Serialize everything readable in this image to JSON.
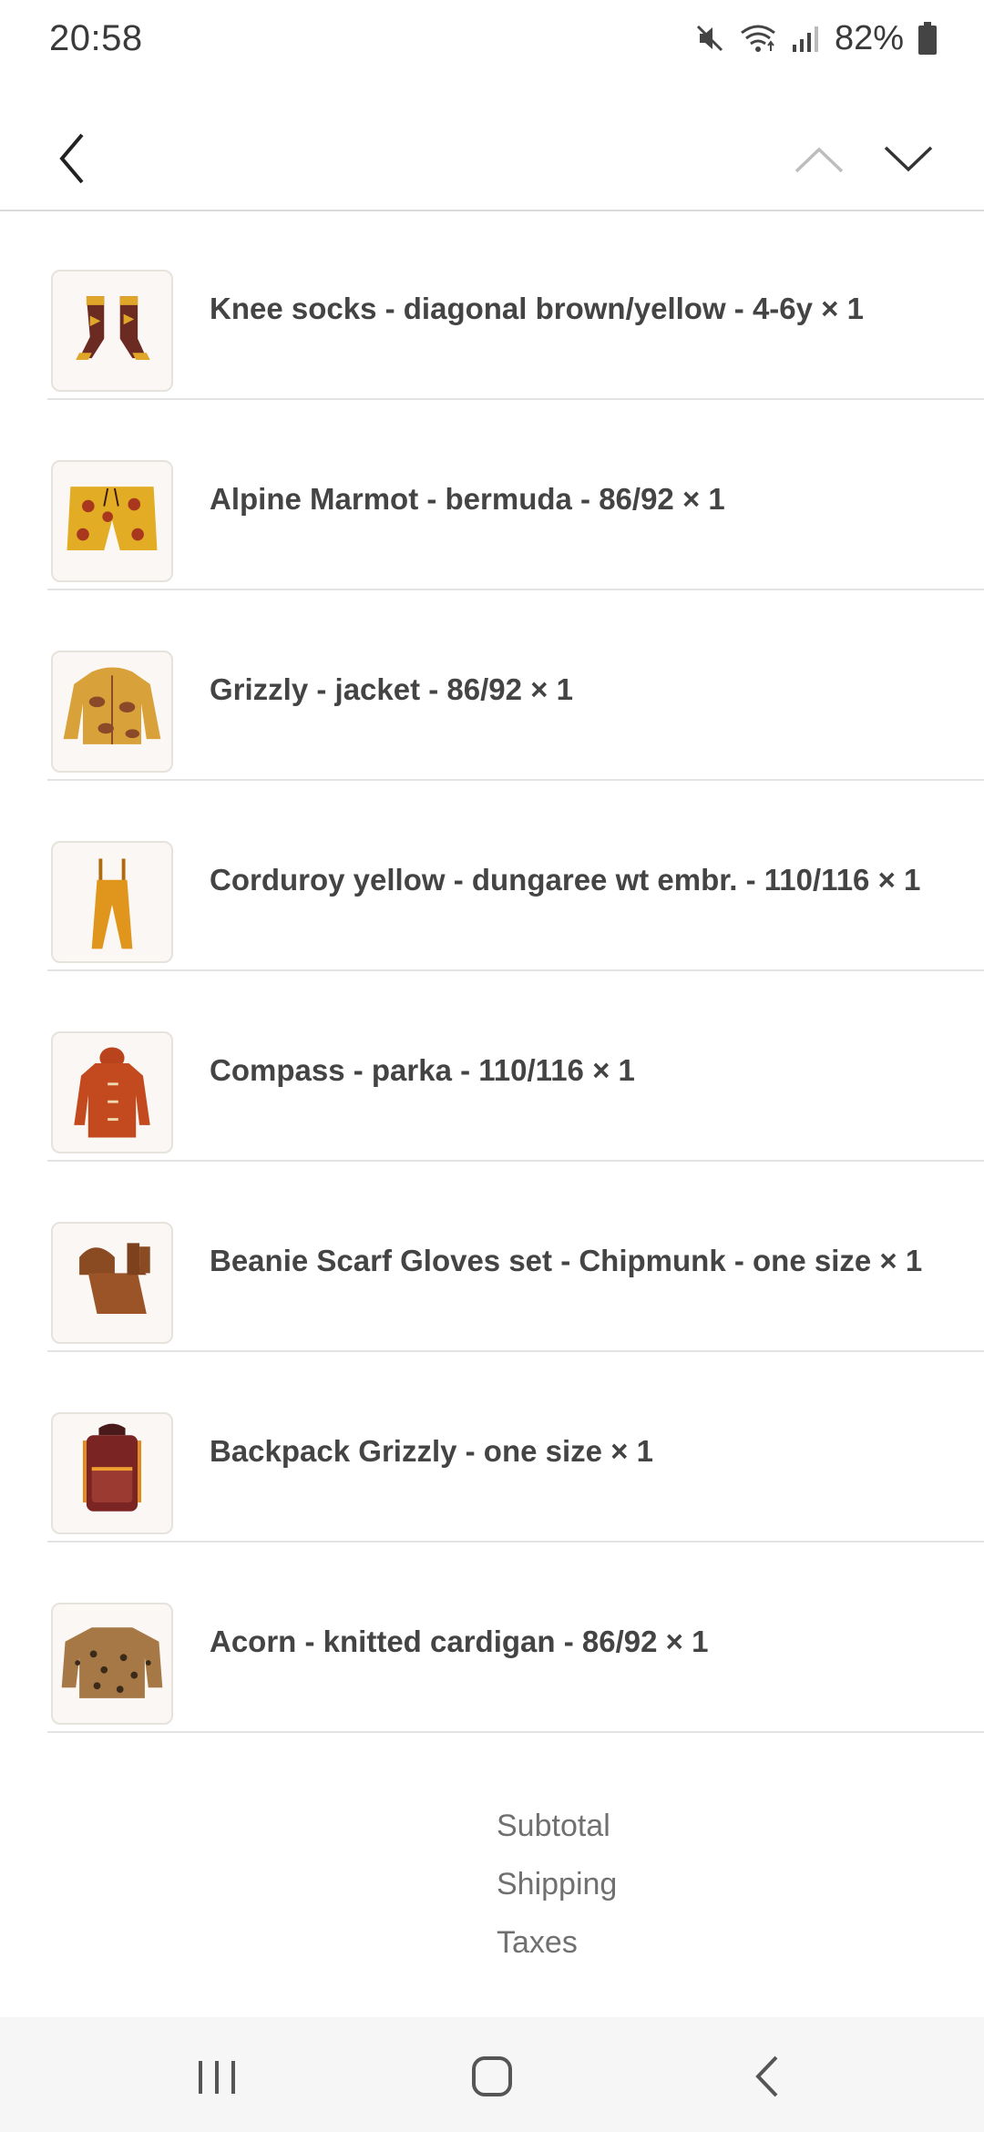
{
  "status_bar": {
    "time": "20:58",
    "battery": "82%",
    "icons": [
      "mute-icon",
      "wifi-icon",
      "signal-icon",
      "battery-icon"
    ]
  },
  "toolbar": {
    "icons": [
      "back-arrow-icon",
      "chevron-up-icon",
      "chevron-down-icon"
    ]
  },
  "items": [
    {
      "title": "Knee socks - diagonal brown/yellow - 4-6y × 1",
      "icon": "socks-icon"
    },
    {
      "title": "Alpine Marmot - bermuda - 86/92 × 1",
      "icon": "shorts-icon"
    },
    {
      "title": "Grizzly - jacket - 86/92 × 1",
      "icon": "jacket-icon"
    },
    {
      "title": "Corduroy yellow - dungaree wt embr. - 110/116 × 1",
      "icon": "dungaree-icon"
    },
    {
      "title": "Compass - parka - 110/116 × 1",
      "icon": "parka-icon"
    },
    {
      "title": "Beanie Scarf Gloves set - Chipmunk - one size × 1",
      "icon": "beanie-set-icon"
    },
    {
      "title": "Backpack Grizzly - one size × 1",
      "icon": "backpack-icon"
    },
    {
      "title": "Acorn - knitted cardigan - 86/92 × 1",
      "icon": "cardigan-icon"
    }
  ],
  "totals": {
    "subtotal_label": "Subtotal",
    "shipping_label": "Shipping",
    "taxes_label": "Taxes"
  },
  "nav_bar": {
    "icons": [
      "recent-apps-icon",
      "home-icon",
      "back-icon"
    ]
  },
  "colors": {
    "divider": "#e3e3e3",
    "text": "#444444",
    "muted_text": "#707070",
    "nav_background": "#f6f6f6"
  }
}
